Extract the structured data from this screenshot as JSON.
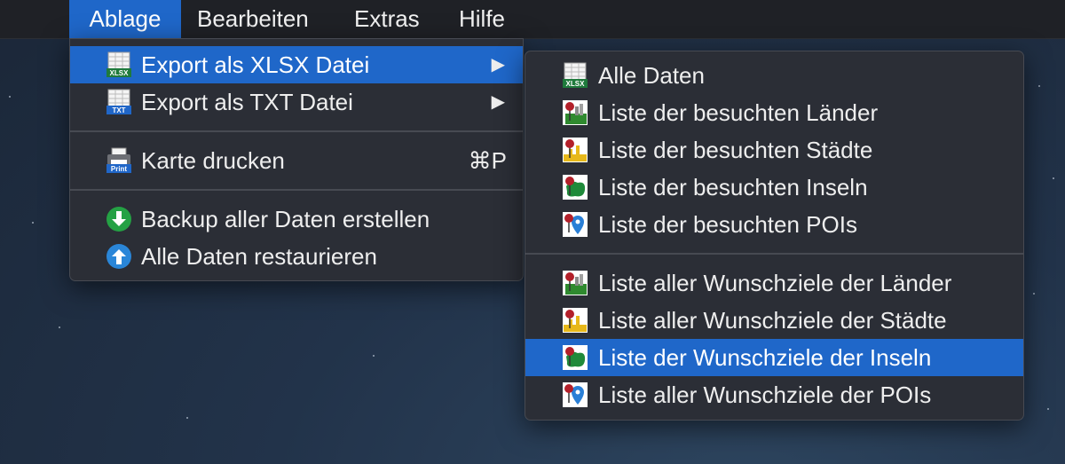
{
  "menubar": {
    "items": [
      "Ablage",
      "Bearbeiten",
      "Extras",
      "Hilfe"
    ]
  },
  "file_menu": {
    "items": [
      {
        "label": "Export als XLSX Datei",
        "icon": "xlsx-icon",
        "has_submenu": true
      },
      {
        "label": "Export als TXT Datei",
        "icon": "txt-icon",
        "has_submenu": true
      },
      {
        "label": "Karte drucken",
        "icon": "print-icon",
        "shortcut": "⌘P"
      },
      {
        "label": "Backup aller Daten erstellen",
        "icon": "download-icon"
      },
      {
        "label": "Alle Daten restaurieren",
        "icon": "upload-icon"
      }
    ]
  },
  "export_submenu": {
    "items": [
      {
        "label": "Alle Daten",
        "icon": "xlsx-icon"
      },
      {
        "label": "Liste der besuchten Länder",
        "icon": "country-pin-icon"
      },
      {
        "label": "Liste der besuchten Städte",
        "icon": "city-pin-icon"
      },
      {
        "label": "Liste der besuchten Inseln",
        "icon": "island-pin-icon"
      },
      {
        "label": "Liste der besuchten POIs",
        "icon": "poi-pin-icon"
      },
      {
        "label": "Liste aller Wunschziele der Länder",
        "icon": "country-pin-icon"
      },
      {
        "label": "Liste aller Wunschziele der Städte",
        "icon": "city-pin-icon"
      },
      {
        "label": "Liste der Wunschziele der Inseln",
        "icon": "island-pin-icon"
      },
      {
        "label": "Liste aller Wunschziele der POIs",
        "icon": "poi-pin-icon"
      }
    ]
  },
  "icon_text": {
    "xlsx": "XLSX",
    "txt": "TXT",
    "print": "Print"
  },
  "colors": {
    "highlight": "#1f67c9",
    "menu_bg": "#2b2e36",
    "menubar_bg": "#1f2126"
  }
}
